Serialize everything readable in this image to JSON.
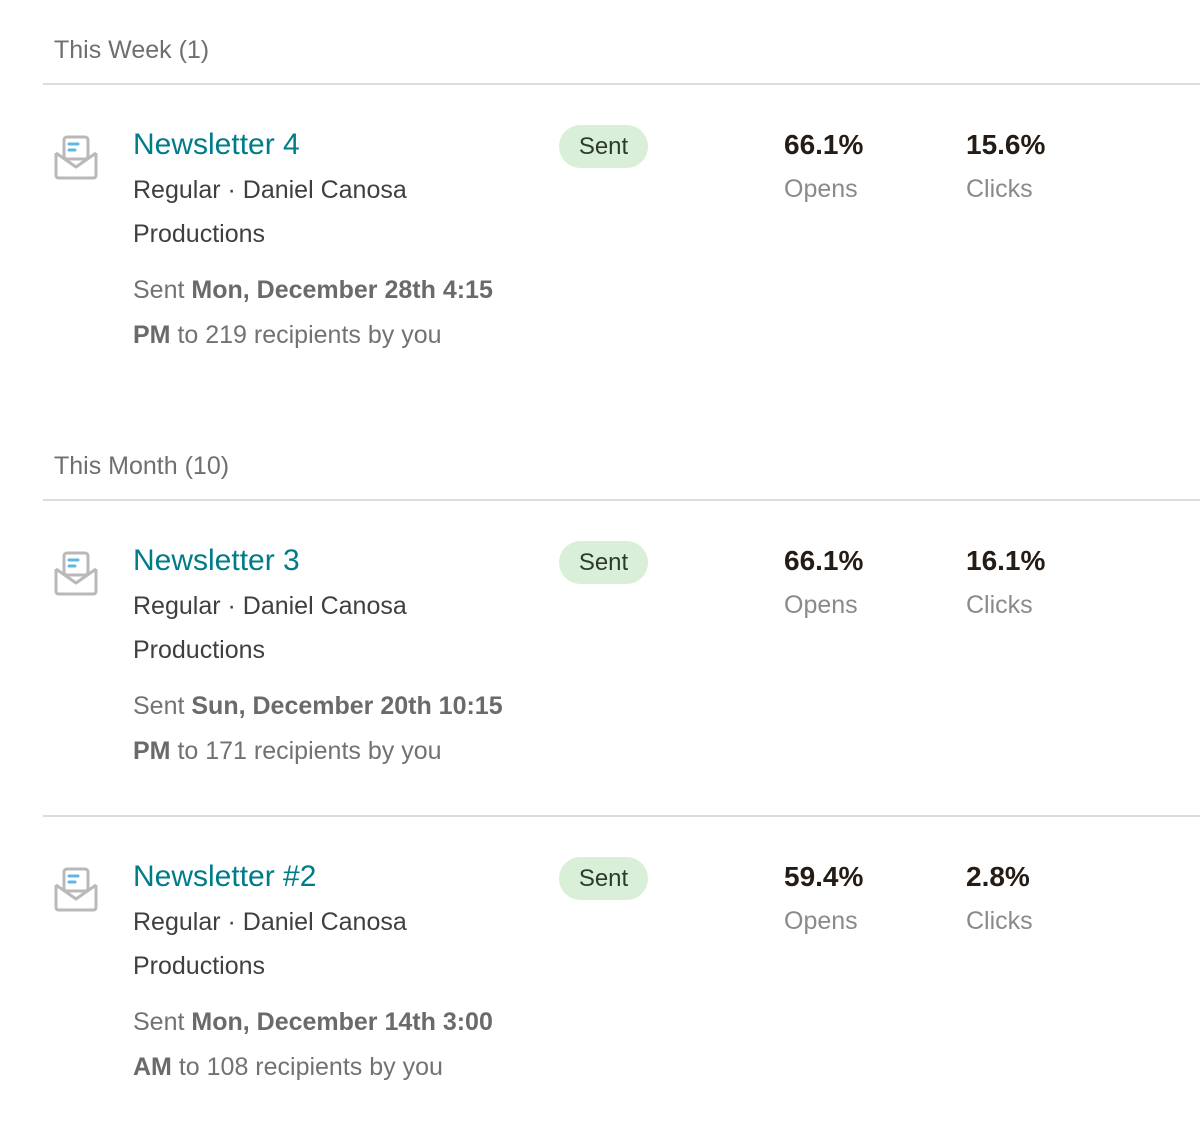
{
  "groups": [
    {
      "header": "This Week (1)",
      "campaigns": [
        {
          "title": "Newsletter 4",
          "meta": "Regular · Daniel Canosa Productions",
          "sent_prefix": "Sent ",
          "sent_date": "Mon, December 28th 4:15 PM",
          "sent_suffix": " to 219 recipients by you",
          "status": "Sent",
          "opens": "66.1%",
          "opens_label": "Opens",
          "clicks": "15.6%",
          "clicks_label": "Clicks"
        }
      ]
    },
    {
      "header": "This Month (10)",
      "campaigns": [
        {
          "title": "Newsletter 3",
          "meta": "Regular · Daniel Canosa Productions",
          "sent_prefix": "Sent ",
          "sent_date": "Sun, December 20th 10:15 PM",
          "sent_suffix": " to 171 recipients by you",
          "status": "Sent",
          "opens": "66.1%",
          "opens_label": "Opens",
          "clicks": "16.1%",
          "clicks_label": "Clicks"
        },
        {
          "title": "Newsletter #2",
          "meta": "Regular · Daniel Canosa Productions",
          "sent_prefix": "Sent ",
          "sent_date": "Mon, December 14th 3:00 AM",
          "sent_suffix": " to 108 recipients by you",
          "status": "Sent",
          "opens": "59.4%",
          "opens_label": "Opens",
          "clicks": "2.8%",
          "clicks_label": "Clicks"
        }
      ]
    }
  ],
  "colors": {
    "title_link": "#007c89",
    "status_badge_bg": "#d9efd7",
    "divider": "#dcdcdc"
  },
  "icons": {
    "campaign": "email-campaign-icon"
  }
}
